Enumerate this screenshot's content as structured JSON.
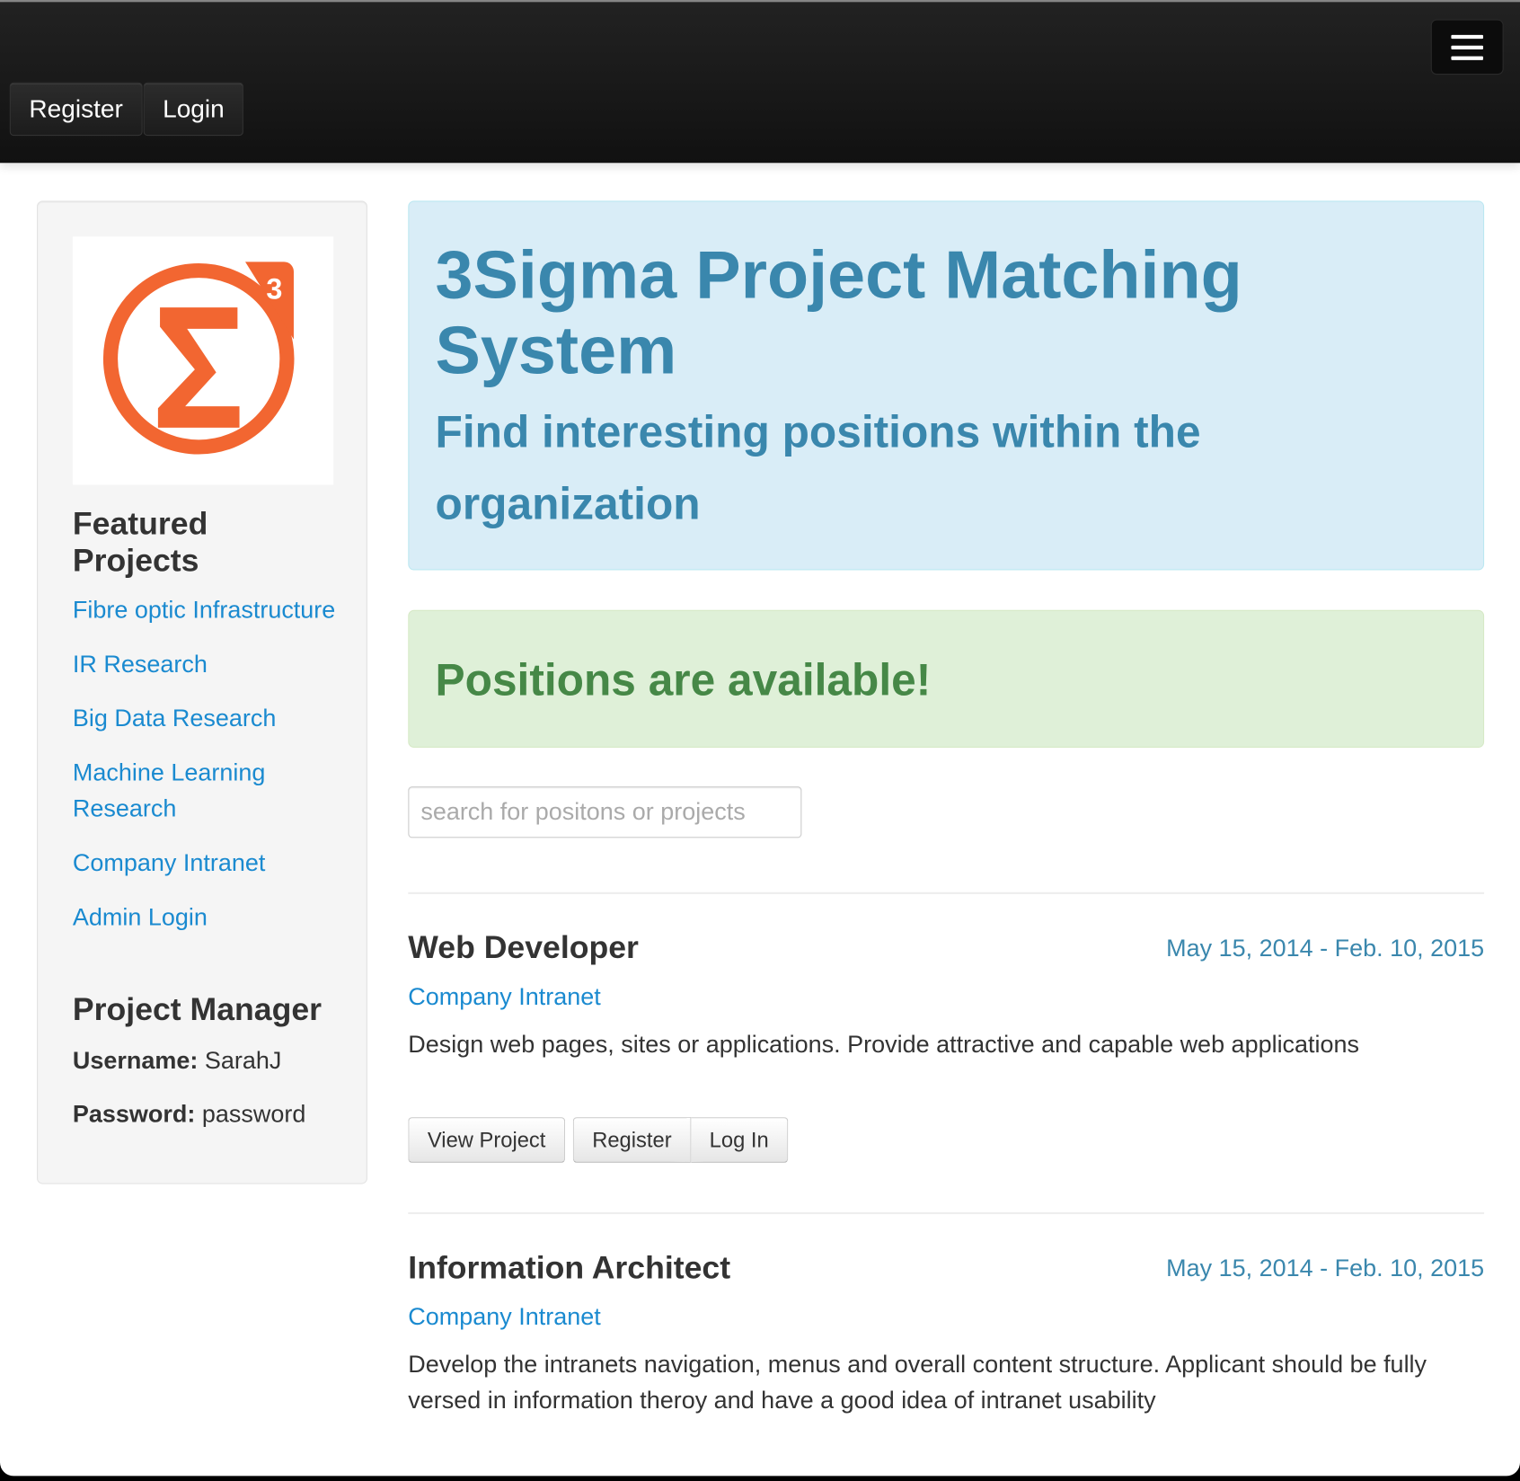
{
  "navbar": {
    "register_label": "Register",
    "login_label": "Login",
    "menu_icon": "hamburger-icon"
  },
  "logo": {
    "text": "Σ3",
    "color": "#f26631"
  },
  "sidebar": {
    "featured_heading": "Featured Projects",
    "links": [
      "Fibre optic Infrastructure",
      "IR Research",
      "Big Data Research",
      "Machine Learning Research",
      "Company Intranet",
      "Admin Login"
    ],
    "manager_heading": "Project Manager",
    "username_label": "Username:",
    "username_value": "SarahJ",
    "password_label": "Password:",
    "password_value": "password"
  },
  "hero": {
    "title": "3Sigma Project Matching System",
    "subtitle": "Find interesting positions within the organization"
  },
  "alert": {
    "text": "Positions are available!"
  },
  "search": {
    "placeholder": "search for positons or projects",
    "value": ""
  },
  "positions": [
    {
      "title": "Web Developer",
      "dates": "May 15, 2014 - Feb. 10, 2015",
      "project": "Company Intranet",
      "description": "Design web pages, sites or applications. Provide attractive and capable web applications",
      "buttons": {
        "view": "View Project",
        "register": "Register",
        "login": "Log In"
      }
    },
    {
      "title": "Information Architect",
      "dates": "May 15, 2014 - Feb. 10, 2015",
      "project": "Company Intranet",
      "description": "Develop the intranets navigation, menus and overall content structure. Applicant should be fully versed in information theroy and have a good idea of intranet usability"
    }
  ],
  "colors": {
    "link": "#1a8ad0",
    "hero_text": "#3a87ad",
    "hero_bg": "#d9edf7",
    "alert_bg": "#dff0d8",
    "alert_text": "#468847"
  }
}
